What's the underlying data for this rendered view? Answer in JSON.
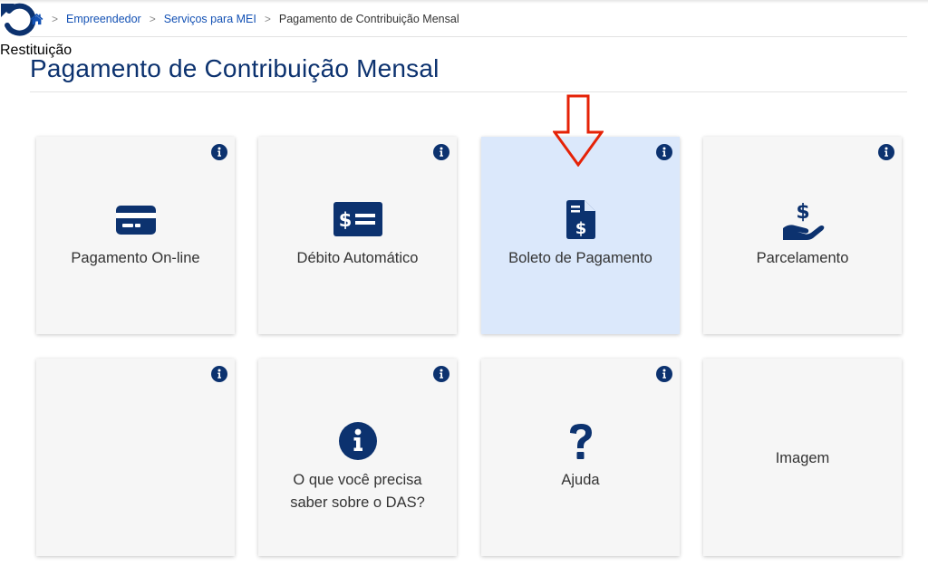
{
  "breadcrumb": {
    "home_icon": "home-icon",
    "separator": ">",
    "items": [
      {
        "label": "Empreendedor"
      },
      {
        "label": "Serviços para MEI"
      }
    ],
    "current": "Pagamento de Contribuição Mensal"
  },
  "page": {
    "title": "Pagamento de Contribuição Mensal"
  },
  "cards": [
    {
      "label": "Pagamento On-line",
      "icon": "credit-card-icon",
      "has_info": true
    },
    {
      "label": "Débito Automático",
      "icon": "money-check-icon",
      "has_info": true
    },
    {
      "label": "Boleto de Pagamento",
      "icon": "invoice-dollar-icon",
      "has_info": true,
      "highlighted": true
    },
    {
      "label": "Parcelamento",
      "icon": "hand-holding-dollar-icon",
      "has_info": true
    },
    {
      "label": "Restituição",
      "icon": "undo-icon",
      "has_info": true
    },
    {
      "label": "O que você precisa\nsaber sobre o DAS?",
      "icon": "info-circle-icon",
      "has_info": true
    },
    {
      "label": "Ajuda",
      "icon": "question-icon",
      "has_info": true
    },
    {
      "label": "Imagem",
      "icon": "",
      "has_info": false
    }
  ],
  "colors": {
    "primary_dark": "#0c326f",
    "link": "#1351b4",
    "card_bg": "#f6f6f6",
    "card_highlight": "#dbe8fb",
    "annotation_arrow": "#e52207"
  }
}
